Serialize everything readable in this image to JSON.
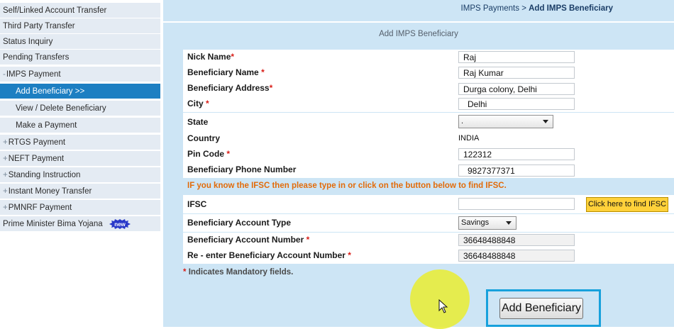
{
  "sidebar": {
    "items": [
      {
        "label": "Self/Linked Account Transfer",
        "prefix": ""
      },
      {
        "label": "Third Party Transfer",
        "prefix": ""
      },
      {
        "label": "Status Inquiry",
        "prefix": ""
      },
      {
        "label": "Pending Transfers",
        "prefix": ""
      },
      {
        "label": "IMPS Payment",
        "prefix": "-"
      },
      {
        "label": "Add Beneficiary >>",
        "prefix": ""
      },
      {
        "label": "View / Delete Beneficiary",
        "prefix": ""
      },
      {
        "label": "Make a Payment",
        "prefix": ""
      },
      {
        "label": "RTGS Payment",
        "prefix": "+"
      },
      {
        "label": "NEFT Payment",
        "prefix": "+"
      },
      {
        "label": "Standing Instruction",
        "prefix": "+"
      },
      {
        "label": "Instant Money Transfer",
        "prefix": "+"
      },
      {
        "label": "PMNRF Payment",
        "prefix": "+"
      },
      {
        "label": "Prime Minister Bima Yojana",
        "prefix": ""
      }
    ],
    "new_badge": "new",
    "active_color": "#1d7fc2"
  },
  "breadcrumb": {
    "parent": "IMPS Payments",
    "separator": ">",
    "current": "Add IMPS Beneficiary"
  },
  "form": {
    "title": "Add IMPS Beneficiary",
    "fields": {
      "nick_name": {
        "label": "Nick Name",
        "required": "*",
        "value": "Raj"
      },
      "beneficiary_name": {
        "label": "Beneficiary Name",
        "required": "*",
        "value": "Raj Kumar"
      },
      "beneficiary_address": {
        "label": "Beneficiary Address",
        "required": "*",
        "value": "Durga colony, Delhi"
      },
      "city": {
        "label": "City",
        "required": "*",
        "value": "Delhi"
      },
      "state": {
        "label": "State",
        "required": "",
        "value": "."
      },
      "country": {
        "label": "Country",
        "required": "",
        "value": "INDIA"
      },
      "pin_code": {
        "label": "Pin Code",
        "required": "*",
        "value": "122312"
      },
      "phone": {
        "label": "Beneficiary Phone Number",
        "required": "",
        "value": "9827377371"
      },
      "ifsc": {
        "label": "IFSC",
        "required": "",
        "value": ""
      },
      "account_type": {
        "label": "Beneficiary Account Type",
        "required": "",
        "value": "Savings"
      },
      "account_number": {
        "label": "Beneficiary Account Number",
        "required": "*",
        "value": "36648488848"
      },
      "reenter_account_number": {
        "label": "Re - enter Beneficiary Account Number",
        "required": "*",
        "value": "36648488848"
      }
    },
    "ifsc_note": "IF you know the IFSC then please type in or click on the button below to find IFSC.",
    "ifsc_button": "Click here to find IFSC",
    "mandatory_note_marker": "*",
    "mandatory_note": "Indicates Mandatory fields.",
    "submit_button": "Add Beneficiary"
  },
  "colors": {
    "sidebar_bg": "#e4ebf3",
    "main_bg": "#cde5f5",
    "required_star": "#d91e18",
    "ifsc_note": "#e26b0a",
    "ifsc_button": "#ffd13a",
    "highlight_frame": "#17a1dc"
  }
}
